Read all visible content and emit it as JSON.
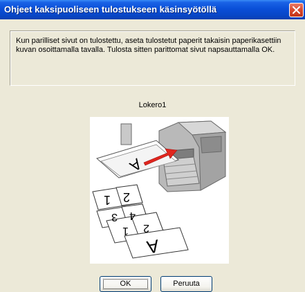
{
  "window": {
    "title": "Ohjeet kaksipuoliseen tulostukseen käsinsyötöllä",
    "close_icon": "close-icon"
  },
  "instructions": {
    "text": "Kun parilliset sivut on tulostettu, aseta tulostetut paperit takaisin paperikasettiin kuvan osoittamalla tavalla. Tulosta sitten parittomat sivut napsauttamalla OK."
  },
  "illustration": {
    "tray_label": "Lokero1",
    "page_marks": {
      "top_sheet": "A",
      "stack_1": "1",
      "stack_2": "2",
      "stack_3": "3",
      "stack_4": "4",
      "stack_5": "1",
      "stack_6": "2",
      "bottom_sheet": "A"
    },
    "arrow_color": "#e0261e"
  },
  "buttons": {
    "ok_label": "OK",
    "cancel_label": "Peruuta"
  }
}
